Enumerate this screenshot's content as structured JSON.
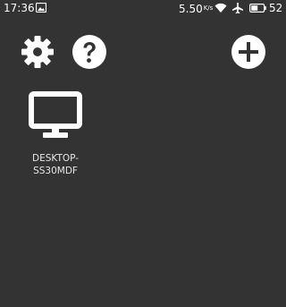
{
  "status_bar": {
    "time": "17:36",
    "network_speed": "5.50",
    "network_speed_unit": "K/s",
    "battery_level": "52",
    "icons": [
      "image-notification-icon",
      "wifi-icon",
      "airplane-mode-icon",
      "battery-icon"
    ]
  },
  "toolbar": {
    "icons": [
      "gear-icon",
      "help-icon",
      "plus-icon"
    ]
  },
  "computers": [
    {
      "name": "DESKTOP-SS30MDF",
      "icon": "monitor-icon"
    }
  ],
  "colors": {
    "background": "#333333",
    "foreground": "#ffffff"
  }
}
